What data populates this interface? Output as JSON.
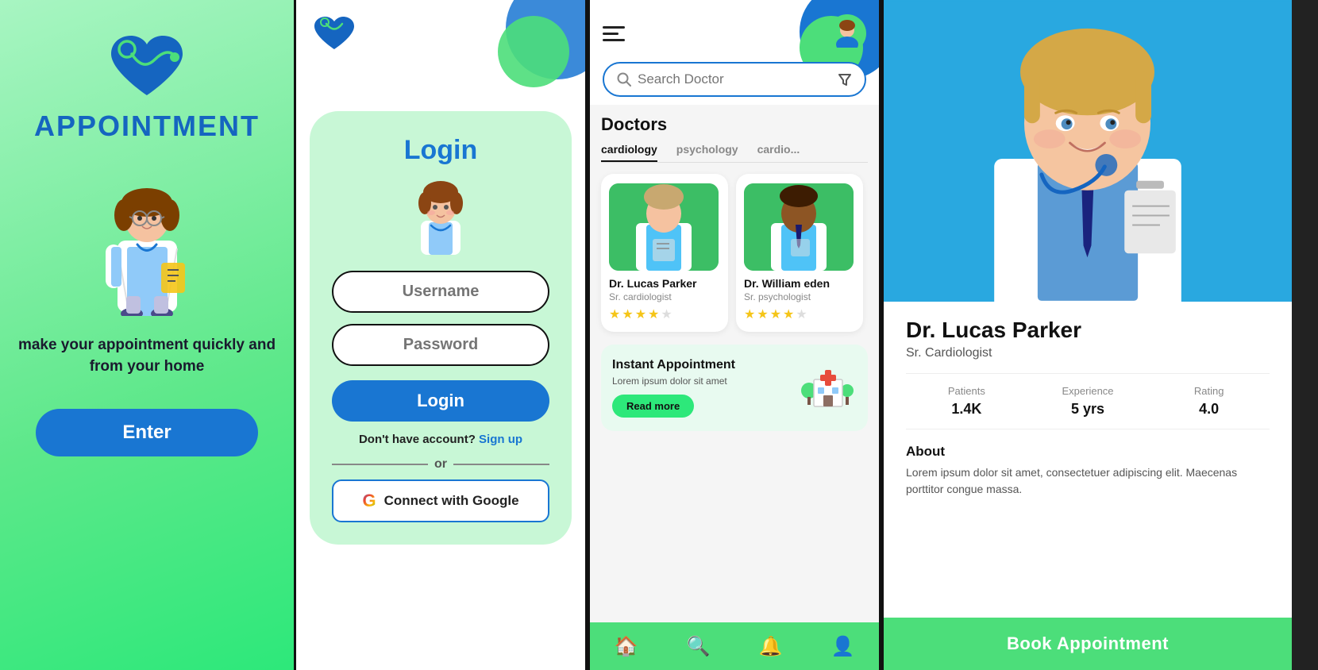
{
  "panel1": {
    "app_title": "APPOINTMENT",
    "tagline": "make your appointment quickly and from your home",
    "enter_btn": "Enter"
  },
  "panel2": {
    "login_title": "Login",
    "username_placeholder": "Username",
    "password_placeholder": "Password",
    "login_btn": "Login",
    "no_account_text": "Don't have account?",
    "signup_link": "Sign up",
    "or_text": "or",
    "google_btn": "Connect with Google"
  },
  "panel3": {
    "search_placeholder": "Search Doctor",
    "section_title": "Doctors",
    "categories": [
      "cardiology",
      "psychology",
      "cardio..."
    ],
    "active_category": "cardiology",
    "doctors": [
      {
        "name": "Dr. Lucas Parker",
        "specialty": "Sr. cardiologist",
        "rating": 4,
        "max_rating": 5
      },
      {
        "name": "Dr. William eden",
        "specialty": "Sr. psychologist",
        "rating": 4,
        "max_rating": 5
      }
    ],
    "instant": {
      "title": "Instant Appointment",
      "desc": "Lorem ipsum dolor sit amet",
      "read_more": "Read more"
    },
    "nav_icons": [
      "home",
      "search",
      "bell",
      "person"
    ]
  },
  "panel4": {
    "doctor_name": "Dr. Lucas Parker",
    "doctor_specialty": "Sr. Cardiologist",
    "stats": [
      {
        "label": "Patients",
        "value": "1.4K"
      },
      {
        "label": "Experience",
        "value": "5 yrs"
      },
      {
        "label": "Rating",
        "value": "4.0"
      }
    ],
    "about_title": "About",
    "about_text": "Lorem ipsum dolor sit amet, consectetuer adipiscing elit. Maecenas porttitor congue massa.",
    "book_btn": "Book  Appointment"
  },
  "colors": {
    "primary_blue": "#1976d2",
    "primary_green": "#4cde7a",
    "light_green": "#c8f7d6",
    "accent_teal": "#29a8e0"
  }
}
